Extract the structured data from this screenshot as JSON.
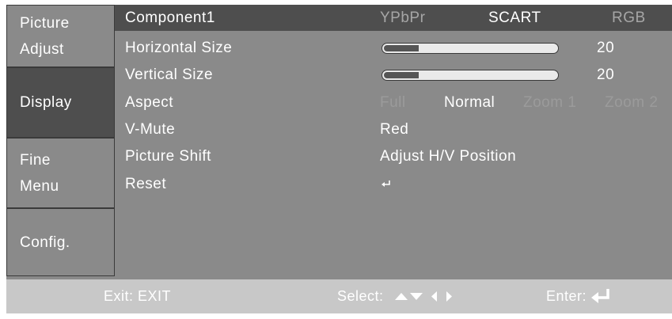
{
  "tabs": [
    {
      "lines": [
        "Picture",
        "Adjust"
      ],
      "active": false
    },
    {
      "lines": [
        "Display"
      ],
      "active": true
    },
    {
      "lines": [
        "Fine",
        "Menu"
      ],
      "active": false
    },
    {
      "lines": [
        "Config."
      ],
      "active": false
    }
  ],
  "header": {
    "label": "Component1",
    "options": [
      "YPbPr",
      "SCART",
      "RGB"
    ],
    "selected": "SCART"
  },
  "rows": {
    "horizontal_size": {
      "label": "Horizontal Size",
      "value": "20",
      "fill_fraction": 0.2
    },
    "vertical_size": {
      "label": "Vertical Size",
      "value": "20",
      "fill_fraction": 0.2
    },
    "aspect": {
      "label": "Aspect",
      "options": [
        "Full",
        "Normal",
        "Zoom 1",
        "Zoom 2"
      ],
      "selected": "Normal"
    },
    "v_mute": {
      "label": "V-Mute",
      "value": "Red"
    },
    "picture_shift": {
      "label": "Picture Shift",
      "value": "Adjust H/V Position"
    },
    "reset": {
      "label": "Reset",
      "icon": "enter-icon"
    }
  },
  "footer": {
    "exit": "Exit: EXIT",
    "select": "Select:",
    "enter": "Enter:"
  },
  "colors": {
    "panel": "#8a8a8a",
    "selected_row": "#4e4e4e",
    "footer": "#c8c8c8",
    "inactive_option": "#a6a6a6"
  }
}
